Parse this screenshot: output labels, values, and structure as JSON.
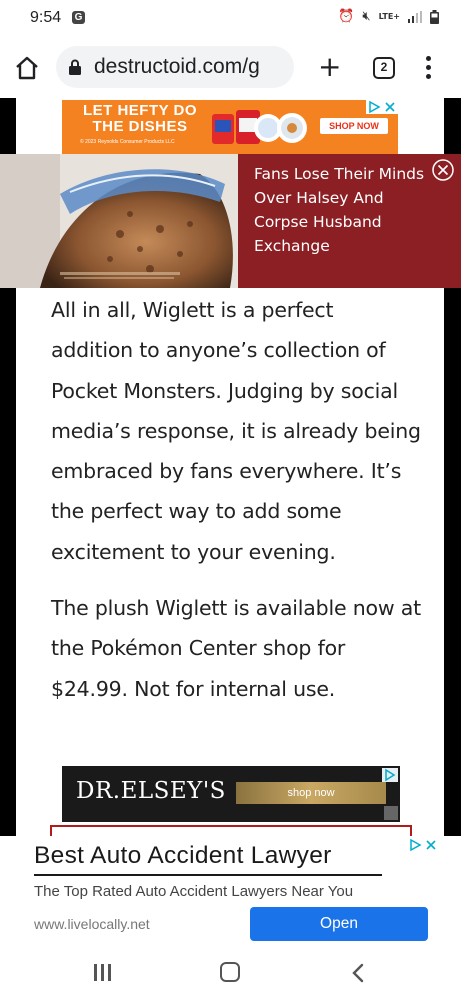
{
  "status_bar": {
    "time": "9:54",
    "app_icon": "G",
    "network": "LTE+",
    "icons": [
      "alarm-icon",
      "mute-icon",
      "lte-icon",
      "signal-icon",
      "battery-icon"
    ]
  },
  "browser": {
    "url": "destructoid.com/g",
    "tab_count": "2",
    "icons": [
      "home-icon",
      "lock-icon",
      "plus-icon",
      "tabs-icon",
      "overflow-menu-icon"
    ]
  },
  "top_ad": {
    "headline": "LET HEFTY DO THE DISHES",
    "legal": "© 2023 Reynolds Consumer Products LLC",
    "cta": "SHOP NOW",
    "colors": {
      "background": "#f58220",
      "cta_text": "#e8321a"
    }
  },
  "float_ad": {
    "headline": "Fans Lose Their Minds Over Halsey And Corpse Husband Exchange",
    "colors": {
      "background": "#8b1f24"
    }
  },
  "article": {
    "paragraphs": [
      "All in all, Wiglett is a perfect addition to anyone’s collection of Pocket Monsters. Judging by social media’s response, it is already being embraced by fans everywhere. It’s the perfect way to add some excitement to your evening.",
      "The plush Wiglett is available now at the Pokémon Center shop for $24.99. Not for internal use."
    ]
  },
  "elsey_ad": {
    "brand": "DR.ELSEY'S",
    "cta": "shop now"
  },
  "bottom_ad": {
    "headline": "Best Auto Accident Lawyer",
    "description": "The Top Rated Auto Accident Lawyers Near You",
    "site": "www.livelocally.net",
    "cta": "Open",
    "colors": {
      "cta": "#1a73e8"
    }
  },
  "nav_bar": {
    "icons": [
      "recent-apps-icon",
      "home-nav-icon",
      "back-icon"
    ]
  }
}
